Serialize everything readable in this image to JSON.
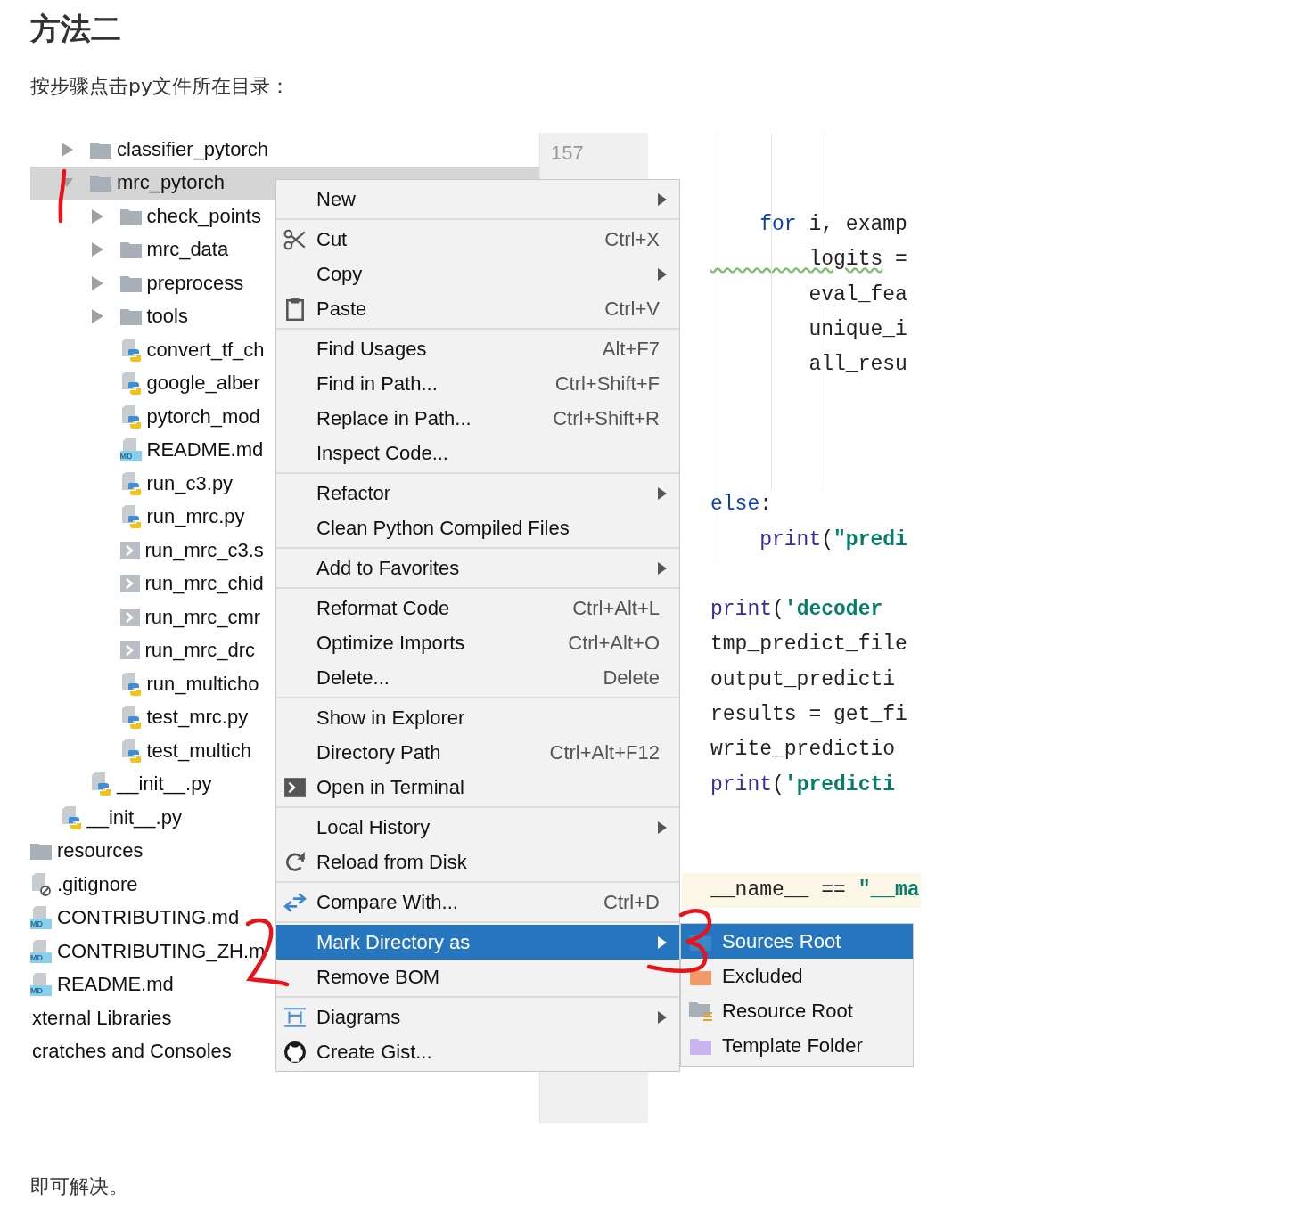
{
  "heading": "方法二",
  "intro": "按步骤点击py文件所在目录：",
  "screenshot": {
    "tree": [
      {
        "children": [
          {
            "children": [
              {
                "children": [
                  {
                    "label": "classifier_pytorch",
                    "kind": "folder",
                    "expanded": false,
                    "selected": false
                  },
                  {
                    "label": "mrc_pytorch",
                    "kind": "folder",
                    "expanded": true,
                    "selected": true,
                    "children": [
                      {
                        "label": "check_points",
                        "kind": "folder",
                        "expanded": false,
                        "selected": false
                      },
                      {
                        "label": "mrc_data",
                        "kind": "folder",
                        "expanded": false,
                        "selected": false
                      },
                      {
                        "label": "preprocess",
                        "kind": "folder",
                        "expanded": false,
                        "selected": false
                      },
                      {
                        "label": "tools",
                        "kind": "folder",
                        "expanded": false,
                        "selected": false
                      },
                      {
                        "label": "convert_tf_ch",
                        "kind": "python",
                        "selected": false
                      },
                      {
                        "label": "google_alber",
                        "kind": "python",
                        "selected": false
                      },
                      {
                        "label": "pytorch_mod",
                        "kind": "python",
                        "selected": false
                      },
                      {
                        "label": "README.md",
                        "kind": "markdown",
                        "badge": "MD",
                        "selected": false
                      },
                      {
                        "label": "run_c3.py",
                        "kind": "python",
                        "selected": false
                      },
                      {
                        "label": "run_mrc.py",
                        "kind": "python",
                        "selected": false
                      },
                      {
                        "label": "run_mrc_c3.s",
                        "kind": "shell",
                        "selected": false
                      },
                      {
                        "label": "run_mrc_chid",
                        "kind": "shell",
                        "selected": false
                      },
                      {
                        "label": "run_mrc_cmr",
                        "kind": "shell",
                        "selected": false
                      },
                      {
                        "label": "run_mrc_drc",
                        "kind": "shell",
                        "selected": false
                      },
                      {
                        "label": "run_multicho",
                        "kind": "python",
                        "selected": false
                      },
                      {
                        "label": "test_mrc.py",
                        "kind": "python",
                        "selected": false
                      },
                      {
                        "label": "test_multich",
                        "kind": "python",
                        "selected": false
                      }
                    ]
                  },
                  {
                    "label": "__init__.py",
                    "kind": "python",
                    "selected": false
                  }
                ]
              },
              {
                "label": "__init__.py",
                "kind": "python",
                "selected": false
              }
            ]
          },
          {
            "label": "resources",
            "kind": "folder",
            "selected": false
          },
          {
            "label": ".gitignore",
            "kind": "ignored",
            "selected": false
          },
          {
            "label": "CONTRIBUTING.md",
            "kind": "markdown",
            "badge": "MD",
            "selected": false
          },
          {
            "label": "CONTRIBUTING_ZH.m",
            "kind": "markdown",
            "badge": "MD",
            "selected": false
          },
          {
            "label": "README.md",
            "kind": "markdown",
            "badge": "MD",
            "selected": false
          }
        ]
      },
      {
        "label": "xternal Libraries",
        "selected": false
      },
      {
        "label": "cratches and Consoles",
        "selected": false
      }
    ],
    "gutter": {
      "line_number": "157"
    },
    "code_blocks": [
      {
        "lines": [
          {
            "highlighted": false,
            "tokens": [
              {
                "text": "    for",
                "kind": "keyword"
              },
              {
                "text": " i, examp",
                "kind": "plain"
              }
            ]
          },
          {
            "highlighted": false,
            "tokens": [
              {
                "text": "        logits",
                "kind": "warned"
              },
              {
                "text": " =",
                "kind": "plain"
              }
            ]
          },
          {
            "highlighted": false,
            "tokens": [
              {
                "text": "        eval_fea",
                "kind": "plain"
              }
            ]
          },
          {
            "highlighted": false,
            "tokens": [
              {
                "text": "        unique_i",
                "kind": "plain"
              }
            ]
          },
          {
            "highlighted": false,
            "tokens": [
              {
                "text": "        all_resu",
                "kind": "plain"
              }
            ]
          }
        ]
      },
      {
        "lines": [
          {
            "highlighted": false,
            "tokens": [
              {
                "text": "else",
                "kind": "keyword"
              },
              {
                "text": ":",
                "kind": "plain"
              }
            ]
          },
          {
            "highlighted": false,
            "tokens": [
              {
                "text": "    print",
                "kind": "builtin"
              },
              {
                "text": "(",
                "kind": "plain"
              },
              {
                "text": "\"predi",
                "kind": "string"
              }
            ]
          }
        ]
      },
      {
        "lines": [
          {
            "highlighted": false,
            "tokens": [
              {
                "text": "print",
                "kind": "builtin"
              },
              {
                "text": "(",
                "kind": "plain"
              },
              {
                "text": "'decoder",
                "kind": "string"
              }
            ]
          },
          {
            "highlighted": false,
            "tokens": [
              {
                "text": "tmp_predict_file",
                "kind": "plain"
              }
            ]
          },
          {
            "highlighted": false,
            "tokens": [
              {
                "text": "output_predicti",
                "kind": "plain"
              }
            ]
          },
          {
            "highlighted": false,
            "tokens": [
              {
                "text": "results = get_fi",
                "kind": "plain"
              }
            ]
          },
          {
            "highlighted": false,
            "tokens": [
              {
                "text": "write_predictio",
                "kind": "plain"
              }
            ]
          },
          {
            "highlighted": false,
            "tokens": [
              {
                "text": "print",
                "kind": "builtin"
              },
              {
                "text": "(",
                "kind": "plain"
              },
              {
                "text": "'predicti",
                "kind": "string"
              }
            ]
          }
        ]
      },
      {
        "lines": [
          {
            "highlighted": true,
            "tokens": [
              {
                "text": "__name__ == ",
                "kind": "plain"
              },
              {
                "text": "\"__ma",
                "kind": "string"
              }
            ]
          }
        ]
      }
    ],
    "menu": {
      "groups": [
        {
          "items": [
            {
              "label": "New",
              "kind": "plain",
              "submenu": true,
              "selected": false
            }
          ]
        },
        {
          "items": [
            {
              "label": "Cut",
              "shortcut": "Ctrl+X",
              "kind": "cut",
              "submenu": false,
              "selected": false
            },
            {
              "label": "Copy",
              "kind": "plain",
              "submenu": true,
              "selected": false
            },
            {
              "label": "Paste",
              "shortcut": "Ctrl+V",
              "kind": "paste",
              "submenu": false,
              "selected": false
            }
          ]
        },
        {
          "items": [
            {
              "label": "Find Usages",
              "shortcut": "Alt+F7",
              "kind": "plain",
              "submenu": false,
              "selected": false
            },
            {
              "label": "Find in Path...",
              "shortcut": "Ctrl+Shift+F",
              "kind": "plain",
              "submenu": false,
              "selected": false
            },
            {
              "label": "Replace in Path...",
              "shortcut": "Ctrl+Shift+R",
              "kind": "plain",
              "submenu": false,
              "selected": false
            },
            {
              "label": "Inspect Code...",
              "kind": "plain",
              "submenu": false,
              "selected": false
            }
          ]
        },
        {
          "items": [
            {
              "label": "Refactor",
              "kind": "plain",
              "submenu": true,
              "selected": false
            },
            {
              "label": "Clean Python Compiled Files",
              "kind": "plain",
              "submenu": false,
              "selected": false
            }
          ]
        },
        {
          "items": [
            {
              "label": "Add to Favorites",
              "kind": "plain",
              "submenu": true,
              "selected": false
            }
          ]
        },
        {
          "items": [
            {
              "label": "Reformat Code",
              "shortcut": "Ctrl+Alt+L",
              "kind": "plain",
              "submenu": false,
              "selected": false
            },
            {
              "label": "Optimize Imports",
              "shortcut": "Ctrl+Alt+O",
              "kind": "plain",
              "submenu": false,
              "selected": false
            },
            {
              "label": "Delete...",
              "shortcut": "Delete",
              "kind": "plain",
              "submenu": false,
              "selected": false
            }
          ]
        },
        {
          "items": [
            {
              "label": "Show in Explorer",
              "kind": "plain",
              "submenu": false,
              "selected": false
            },
            {
              "label": "Directory Path",
              "shortcut": "Ctrl+Alt+F12",
              "kind": "plain",
              "submenu": false,
              "selected": false
            },
            {
              "label": "Open in Terminal",
              "kind": "terminal",
              "submenu": false,
              "selected": false
            }
          ]
        },
        {
          "items": [
            {
              "label": "Local History",
              "kind": "plain",
              "submenu": true,
              "selected": false
            },
            {
              "label": "Reload from Disk",
              "kind": "reload",
              "submenu": false,
              "selected": false
            }
          ]
        },
        {
          "items": [
            {
              "label": "Compare With...",
              "shortcut": "Ctrl+D",
              "kind": "compare",
              "submenu": false,
              "selected": false
            }
          ]
        },
        {
          "items": [
            {
              "label": "Mark Directory as",
              "kind": "plain",
              "submenu": true,
              "selected": true
            },
            {
              "label": "Remove BOM",
              "kind": "plain",
              "submenu": false,
              "selected": false
            }
          ]
        },
        {
          "items": [
            {
              "label": "Diagrams",
              "kind": "diagrams",
              "submenu": true,
              "selected": false
            },
            {
              "label": "Create Gist...",
              "kind": "gist",
              "submenu": false,
              "selected": false
            }
          ]
        }
      ]
    },
    "submenu": {
      "items": [
        {
          "label": "Sources Root",
          "kind": "sources",
          "selected": true
        },
        {
          "label": "Excluded",
          "kind": "excluded",
          "selected": false
        },
        {
          "label": "Resource Root",
          "kind": "resources",
          "selected": false
        },
        {
          "label": "Template Folder",
          "kind": "template",
          "selected": false
        }
      ]
    }
  },
  "closing": "即可解决。"
}
